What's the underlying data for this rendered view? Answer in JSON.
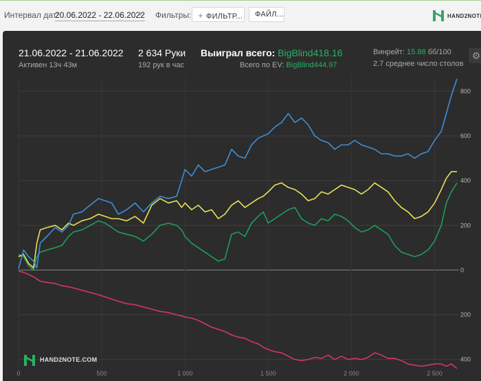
{
  "toolbar": {
    "date_interval_label": "Интервал дат:",
    "date_range": "20.06.2022 - 22.06.2022",
    "filters_label": "Фильтры:",
    "filter_button": "ФИЛЬТР...",
    "file_button": "ФАЙЛ...",
    "brand": "HAND2NOTE"
  },
  "summary": {
    "session_dates": "21.06.2022 - 21.06.2022",
    "active_time": "Активен 13ч 43м",
    "hands": "2 634 Руки",
    "hands_per_hour": "192 рук в час",
    "won_total_label": "Выиграл всего:",
    "won_total_value": "BigBlind418.16",
    "ev_total_label": "Всего по EV:",
    "ev_total_value": "BigBlind444.97",
    "winrate_label": "Винрейт:",
    "winrate_value": "15.88",
    "winrate_unit": "бб/100",
    "avg_tables": "2.7 среднее число столов"
  },
  "watermark": "HAND2NOTE.COM",
  "colors": {
    "panel_bg": "#2c2c2c",
    "won": "#3d8fd8",
    "ev": "#e8e35a",
    "showdown": "#1f9e5a",
    "non_showdown": "#d6336c",
    "accent_green": "#27b364"
  },
  "chart_data": {
    "type": "line",
    "xlim": [
      0,
      2634
    ],
    "ylim": [
      -450,
      870
    ],
    "x_ticks": [
      0,
      500,
      1000,
      1500,
      2000,
      2500
    ],
    "x_tick_labels": [
      "0",
      "500",
      "1 000",
      "1 500",
      "2 000",
      "2 500"
    ],
    "y_ticks": [
      800,
      600,
      400,
      200,
      0,
      -200,
      -400
    ],
    "y_tick_labels": [
      "800",
      "600",
      "400",
      "200",
      "0",
      "200",
      "400"
    ],
    "grid": true,
    "series": [
      {
        "key": "won",
        "x": [
          0,
          30,
          60,
          90,
          110,
          130,
          170,
          220,
          260,
          300,
          330,
          380,
          430,
          480,
          520,
          560,
          600,
          650,
          700,
          750,
          800,
          850,
          900,
          950,
          980,
          1000,
          1040,
          1080,
          1120,
          1160,
          1200,
          1240,
          1280,
          1320,
          1360,
          1400,
          1440,
          1470,
          1500,
          1540,
          1580,
          1620,
          1660,
          1700,
          1740,
          1780,
          1820,
          1860,
          1900,
          1940,
          1980,
          2020,
          2060,
          2100,
          2140,
          2180,
          2220,
          2260,
          2300,
          2340,
          2380,
          2420,
          2460,
          2500,
          2540,
          2570,
          2600,
          2634
        ],
        "values": [
          5,
          90,
          60,
          40,
          10,
          120,
          150,
          190,
          170,
          200,
          250,
          260,
          290,
          320,
          310,
          300,
          250,
          270,
          300,
          260,
          300,
          330,
          320,
          330,
          400,
          450,
          420,
          470,
          440,
          450,
          460,
          470,
          540,
          510,
          500,
          560,
          590,
          600,
          610,
          640,
          660,
          700,
          660,
          680,
          650,
          600,
          580,
          570,
          540,
          560,
          560,
          580,
          560,
          550,
          540,
          520,
          520,
          510,
          510,
          520,
          500,
          520,
          530,
          580,
          620,
          700,
          780,
          855
        ]
      },
      {
        "key": "ev",
        "x": [
          0,
          30,
          60,
          90,
          110,
          130,
          170,
          220,
          260,
          300,
          330,
          380,
          430,
          480,
          520,
          560,
          600,
          650,
          700,
          750,
          800,
          850,
          900,
          950,
          980,
          1000,
          1040,
          1080,
          1120,
          1160,
          1200,
          1240,
          1280,
          1320,
          1360,
          1400,
          1440,
          1470,
          1500,
          1540,
          1580,
          1620,
          1660,
          1700,
          1740,
          1780,
          1820,
          1860,
          1900,
          1940,
          1980,
          2020,
          2060,
          2100,
          2140,
          2180,
          2220,
          2260,
          2300,
          2340,
          2380,
          2420,
          2460,
          2500,
          2540,
          2570,
          2600,
          2634
        ],
        "values": [
          60,
          70,
          30,
          10,
          120,
          180,
          190,
          200,
          180,
          210,
          200,
          220,
          230,
          250,
          240,
          230,
          230,
          220,
          240,
          210,
          290,
          320,
          300,
          310,
          280,
          300,
          270,
          290,
          260,
          270,
          230,
          250,
          290,
          310,
          280,
          300,
          320,
          330,
          350,
          380,
          390,
          370,
          360,
          340,
          310,
          320,
          350,
          340,
          360,
          380,
          370,
          360,
          340,
          360,
          390,
          370,
          350,
          310,
          280,
          260,
          230,
          240,
          260,
          300,
          360,
          410,
          440,
          440
        ]
      },
      {
        "key": "showdown",
        "x": [
          0,
          30,
          60,
          90,
          110,
          130,
          170,
          220,
          260,
          300,
          330,
          380,
          430,
          480,
          520,
          560,
          600,
          650,
          700,
          750,
          800,
          850,
          900,
          950,
          980,
          1000,
          1040,
          1080,
          1120,
          1160,
          1200,
          1240,
          1280,
          1320,
          1360,
          1400,
          1440,
          1470,
          1500,
          1540,
          1580,
          1620,
          1660,
          1700,
          1740,
          1780,
          1820,
          1860,
          1900,
          1940,
          1980,
          2020,
          2060,
          2100,
          2140,
          2180,
          2220,
          2260,
          2300,
          2340,
          2380,
          2420,
          2460,
          2500,
          2540,
          2570,
          2600,
          2634
        ],
        "values": [
          70,
          60,
          20,
          0,
          60,
          80,
          90,
          100,
          110,
          150,
          170,
          180,
          200,
          220,
          210,
          190,
          170,
          160,
          150,
          130,
          160,
          200,
          210,
          200,
          180,
          150,
          120,
          100,
          80,
          60,
          40,
          50,
          160,
          170,
          150,
          210,
          240,
          260,
          210,
          230,
          250,
          270,
          280,
          230,
          210,
          200,
          230,
          220,
          250,
          240,
          220,
          190,
          170,
          180,
          200,
          180,
          160,
          110,
          80,
          70,
          60,
          70,
          90,
          130,
          200,
          300,
          350,
          390
        ]
      },
      {
        "key": "non_showdown",
        "x": [
          0,
          30,
          60,
          90,
          110,
          130,
          170,
          220,
          260,
          300,
          330,
          380,
          430,
          480,
          520,
          560,
          600,
          650,
          700,
          750,
          800,
          850,
          900,
          950,
          980,
          1000,
          1040,
          1080,
          1120,
          1160,
          1200,
          1240,
          1280,
          1320,
          1360,
          1400,
          1440,
          1470,
          1500,
          1540,
          1580,
          1620,
          1660,
          1700,
          1740,
          1780,
          1820,
          1860,
          1900,
          1940,
          1980,
          2020,
          2060,
          2100,
          2140,
          2180,
          2220,
          2260,
          2300,
          2340,
          2380,
          2420,
          2460,
          2500,
          2540,
          2570,
          2600,
          2634
        ],
        "values": [
          -5,
          -10,
          -20,
          -30,
          -40,
          -50,
          -55,
          -60,
          -70,
          -75,
          -80,
          -90,
          -100,
          -110,
          -120,
          -130,
          -140,
          -150,
          -155,
          -165,
          -175,
          -185,
          -190,
          -200,
          -205,
          -210,
          -215,
          -225,
          -240,
          -255,
          -265,
          -275,
          -290,
          -300,
          -305,
          -320,
          -330,
          -345,
          -355,
          -365,
          -370,
          -385,
          -400,
          -405,
          -400,
          -390,
          -395,
          -380,
          -400,
          -385,
          -400,
          -395,
          -400,
          -390,
          -370,
          -380,
          -395,
          -395,
          -405,
          -420,
          -425,
          -430,
          -425,
          -420,
          -420,
          -430,
          -420,
          -440
        ]
      }
    ]
  }
}
